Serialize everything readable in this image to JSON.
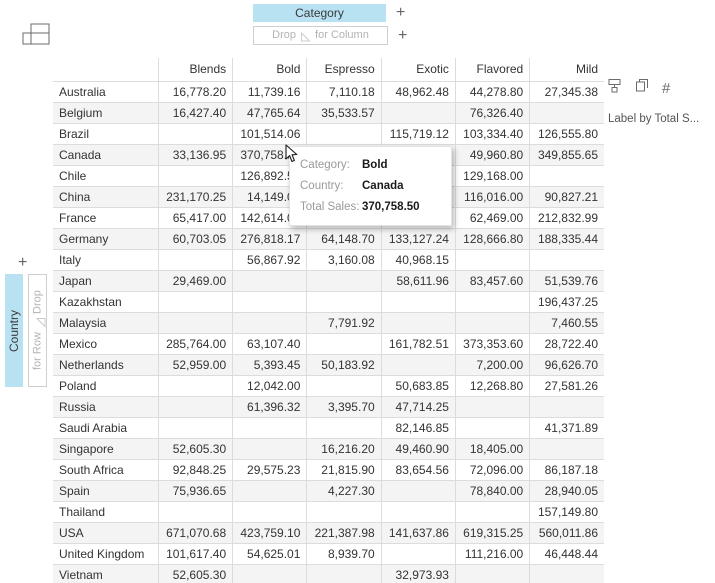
{
  "icons": {
    "pivot": "pivot-layout-icon",
    "add": "+",
    "triangle": "drag-triangle-icon"
  },
  "column_zone": {
    "chip_label": "Category",
    "placeholder_prefix": "Drop",
    "placeholder_suffix": "for Column",
    "add_label": "+",
    "chip_color": "#b8e2f2"
  },
  "row_zone": {
    "chip_label": "Country",
    "placeholder_prefix": "Drop",
    "placeholder_suffix": "for Row",
    "add_label": "+",
    "chip_color": "#b8e2f2"
  },
  "right_panel": {
    "icons": [
      "label-roller-icon",
      "duplicate-icon",
      "number-hash-icon"
    ],
    "hash_glyph": "#",
    "label_text": "Label by Total S..."
  },
  "tooltip": {
    "rows": [
      {
        "key": "Category:",
        "value": "Bold"
      },
      {
        "key": "Country:",
        "value": "Canada"
      },
      {
        "key": "Total Sales:",
        "value": "370,758.50"
      }
    ]
  },
  "table": {
    "corner": "",
    "columns": [
      "Blends",
      "Bold",
      "Espresso",
      "Exotic",
      "Flavored",
      "Mild"
    ],
    "rows": [
      {
        "country": "Australia",
        "values": [
          "16,778.20",
          "11,739.16",
          "7,110.18",
          "48,962.48",
          "44,278.80",
          "27,345.38"
        ]
      },
      {
        "country": "Belgium",
        "values": [
          "16,427.40",
          "47,765.64",
          "35,533.57",
          "",
          "76,326.40",
          ""
        ]
      },
      {
        "country": "Brazil",
        "values": [
          "",
          "101,514.06",
          "",
          "115,719.12",
          "103,334.40",
          "126,555.80"
        ]
      },
      {
        "country": "Canada",
        "values": [
          "33,136.95",
          "370,758.50",
          "",
          "",
          "49,960.80",
          "349,855.65"
        ]
      },
      {
        "country": "Chile",
        "values": [
          "",
          "126,892.50",
          "",
          "",
          "129,168.00",
          ""
        ]
      },
      {
        "country": "China",
        "values": [
          "231,170.25",
          "14,149.00",
          "",
          "",
          "116,016.00",
          "90,827.21"
        ]
      },
      {
        "country": "France",
        "values": [
          "65,417.00",
          "142,614.00",
          "",
          "",
          "62,469.00",
          "212,832.99"
        ]
      },
      {
        "country": "Germany",
        "values": [
          "60,703.05",
          "276,818.17",
          "64,148.70",
          "133,127.24",
          "128,666.80",
          "188,335.44"
        ]
      },
      {
        "country": "Italy",
        "values": [
          "",
          "56,867.92",
          "3,160.08",
          "40,968.15",
          "",
          ""
        ]
      },
      {
        "country": "Japan",
        "values": [
          "29,469.00",
          "",
          "",
          "58,611.96",
          "83,457.60",
          "51,539.76"
        ]
      },
      {
        "country": "Kazakhstan",
        "values": [
          "",
          "",
          "",
          "",
          "",
          "196,437.25"
        ]
      },
      {
        "country": "Malaysia",
        "values": [
          "",
          "",
          "7,791.92",
          "",
          "",
          "7,460.55"
        ]
      },
      {
        "country": "Mexico",
        "values": [
          "285,764.00",
          "63,107.40",
          "",
          "161,782.51",
          "373,353.60",
          "28,722.40"
        ]
      },
      {
        "country": "Netherlands",
        "values": [
          "52,959.00",
          "5,393.45",
          "50,183.92",
          "",
          "7,200.00",
          "96,626.70"
        ]
      },
      {
        "country": "Poland",
        "values": [
          "",
          "12,042.00",
          "",
          "50,683.85",
          "12,268.80",
          "27,581.26"
        ]
      },
      {
        "country": "Russia",
        "values": [
          "",
          "61,396.32",
          "3,395.70",
          "47,714.25",
          "",
          ""
        ]
      },
      {
        "country": "Saudi Arabia",
        "values": [
          "",
          "",
          "",
          "82,146.85",
          "",
          "41,371.89"
        ]
      },
      {
        "country": "Singapore",
        "values": [
          "52,605.30",
          "",
          "16,216.20",
          "49,460.90",
          "18,405.00",
          ""
        ]
      },
      {
        "country": "South Africa",
        "values": [
          "92,848.25",
          "29,575.23",
          "21,815.90",
          "83,654.56",
          "72,096.00",
          "86,187.18"
        ]
      },
      {
        "country": "Spain",
        "values": [
          "75,936.65",
          "",
          "4,227.30",
          "",
          "78,840.00",
          "28,940.05"
        ]
      },
      {
        "country": "Thailand",
        "values": [
          "",
          "",
          "",
          "",
          "",
          "157,149.80"
        ]
      },
      {
        "country": "USA",
        "values": [
          "671,070.68",
          "423,759.10",
          "221,387.98",
          "141,637.86",
          "619,315.25",
          "560,011.86"
        ]
      },
      {
        "country": "United Kingdom",
        "values": [
          "101,617.40",
          "54,625.01",
          "8,939.70",
          "",
          "111,216.00",
          "46,448.44"
        ]
      },
      {
        "country": "Vietnam",
        "values": [
          "52,605.30",
          "",
          "",
          "32,973.93",
          "",
          ""
        ]
      }
    ]
  }
}
